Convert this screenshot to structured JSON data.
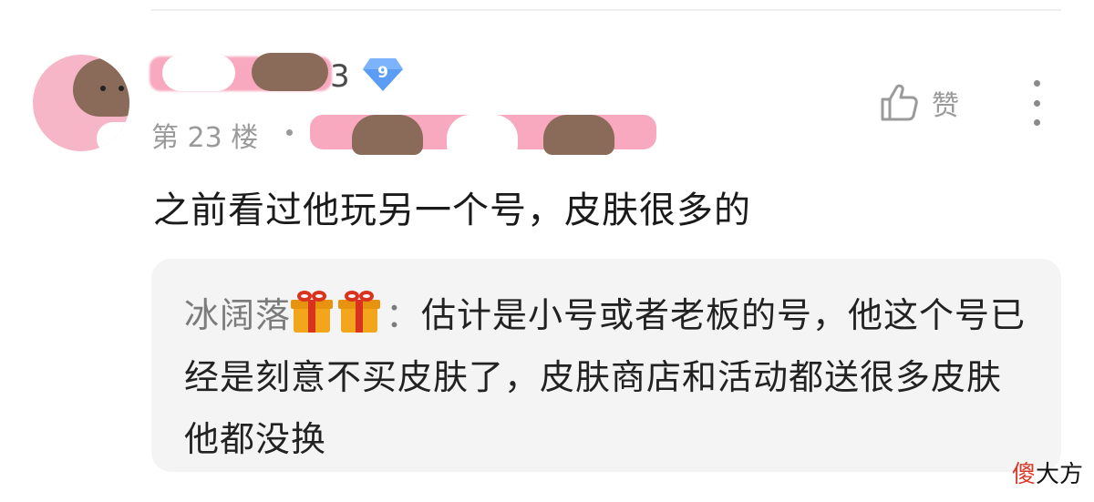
{
  "comment": {
    "username_suffix": "3",
    "level": "9",
    "floor": "第 23 楼",
    "like_label": "赞",
    "text": "之前看过他玩另一个号，皮肤很多的"
  },
  "reply": {
    "author": "冰阔落",
    "separator": "：",
    "text": "估计是小号或者老板的号，他这个号已经是刻意不买皮肤了，皮肤商店和活动都送很多皮肤他都没换"
  },
  "watermark": {
    "first": "傻",
    "rest": "大方"
  },
  "colors": {
    "accent_badge": "#5b9df5",
    "muted_text": "#9a9a9a",
    "reply_bg": "#f4f4f5"
  },
  "icons": [
    "thumbs-up-icon",
    "more-vertical-icon",
    "gift-icon",
    "level-badge-icon"
  ]
}
